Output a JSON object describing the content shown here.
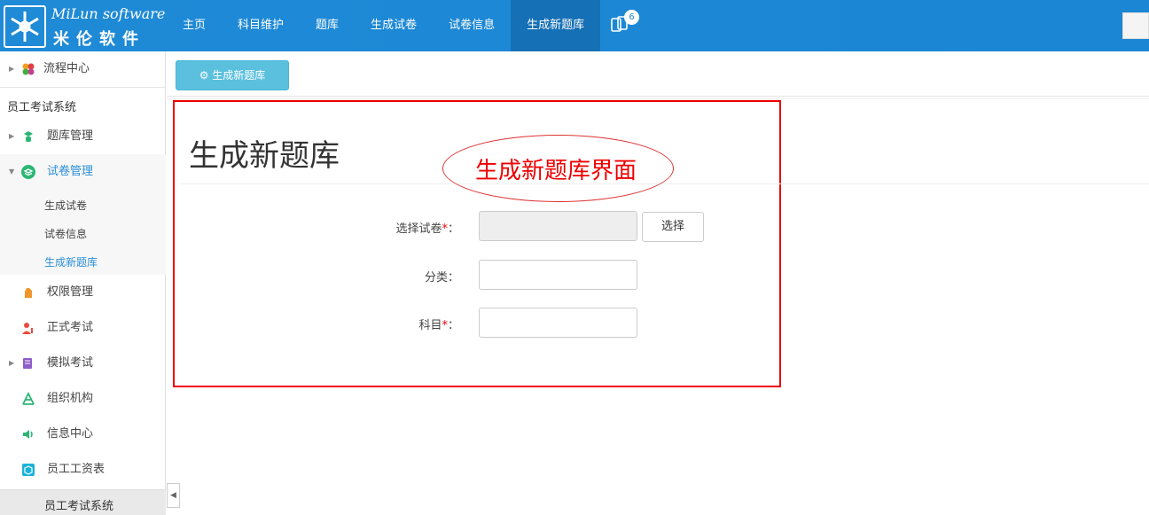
{
  "app": {
    "logo_en": "MiLun software",
    "logo_cn": "米伦软件",
    "nav": [
      "主页",
      "科目维护",
      "题库",
      "生成试卷",
      "试卷信息",
      "生成新题库"
    ],
    "nav_active": "生成新题库",
    "notification_count": "6"
  },
  "sidebar": {
    "top_item": "流程中心",
    "section": "员工考试系统",
    "items": {
      "bank": "题库管理",
      "paper": "试卷管理",
      "sub_generate": "生成试卷",
      "sub_info": "试卷信息",
      "sub_new_bank": "生成新题库",
      "perm": "权限管理",
      "exam": "正式考试",
      "mock": "模拟考试",
      "org": "组织机构",
      "msg": "信息中心",
      "salary": "员工工资表"
    },
    "bottom_label": "员工考试系统"
  },
  "main": {
    "toolbar_button": "生成新题库",
    "page_title": "生成新题库",
    "annotation": "生成新题库界面",
    "form": {
      "paper_label": "选择试卷",
      "category_label": "分类：",
      "subject_label": "科目",
      "colon": "：",
      "required_mark": "*",
      "pick_button": "选择",
      "paper_value": "",
      "category_value": "",
      "subject_value": ""
    }
  },
  "colors": {
    "topbar": "#1f8ad6",
    "nav_active": "#1570b5",
    "accent": "#2a8ed6",
    "info_button": "#5bc0de",
    "annotation_red": "#e00000"
  }
}
